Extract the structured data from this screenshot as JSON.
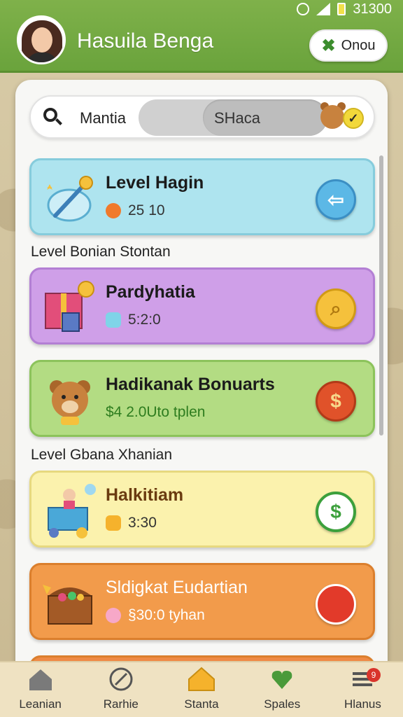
{
  "status_bar": {
    "time": "31300"
  },
  "header": {
    "player_name": "Hasuila Benga",
    "menu_button_label": "Onou",
    "menu_button_icon": "x-icon"
  },
  "search": {
    "label": "Mantia",
    "toggle_label": "SHaca"
  },
  "sections": [
    {
      "label": "Level Bonian Stontan"
    },
    {
      "label": "Level Gbana Xhanian"
    }
  ],
  "cards": [
    {
      "title": "Level Hagin",
      "stat": "25 10",
      "color": "#aee4ef",
      "action_icon": "arrow-icon"
    },
    {
      "title": "Pardyhatia",
      "stat": "5:2:0",
      "color": "#cf9fe8",
      "action_icon": "coin-search-icon"
    },
    {
      "title": "Hadikanak Bonuarts",
      "stat": "$4 2.0Uto tplen",
      "color": "#b3dc83",
      "action_icon": "dollar-coin-icon"
    },
    {
      "title": "Halkitiam",
      "stat": "3:30",
      "color": "#fbf2ad",
      "action_icon": "dollar-bubble-icon"
    },
    {
      "title": "Sldigkat Eudartian",
      "stat": "§30:0 tyhan",
      "color": "#f29b4b",
      "action_icon": "red-gem-icon"
    }
  ],
  "bottom_nav": [
    {
      "label": "Leanian",
      "icon": "home-icon"
    },
    {
      "label": "Rarhie",
      "icon": "compass-icon"
    },
    {
      "label": "Stanta",
      "icon": "house-gold-icon"
    },
    {
      "label": "Spales",
      "icon": "heart-leaf-icon"
    },
    {
      "label": "Hlanus",
      "icon": "menu-icon",
      "badge": "9"
    }
  ]
}
